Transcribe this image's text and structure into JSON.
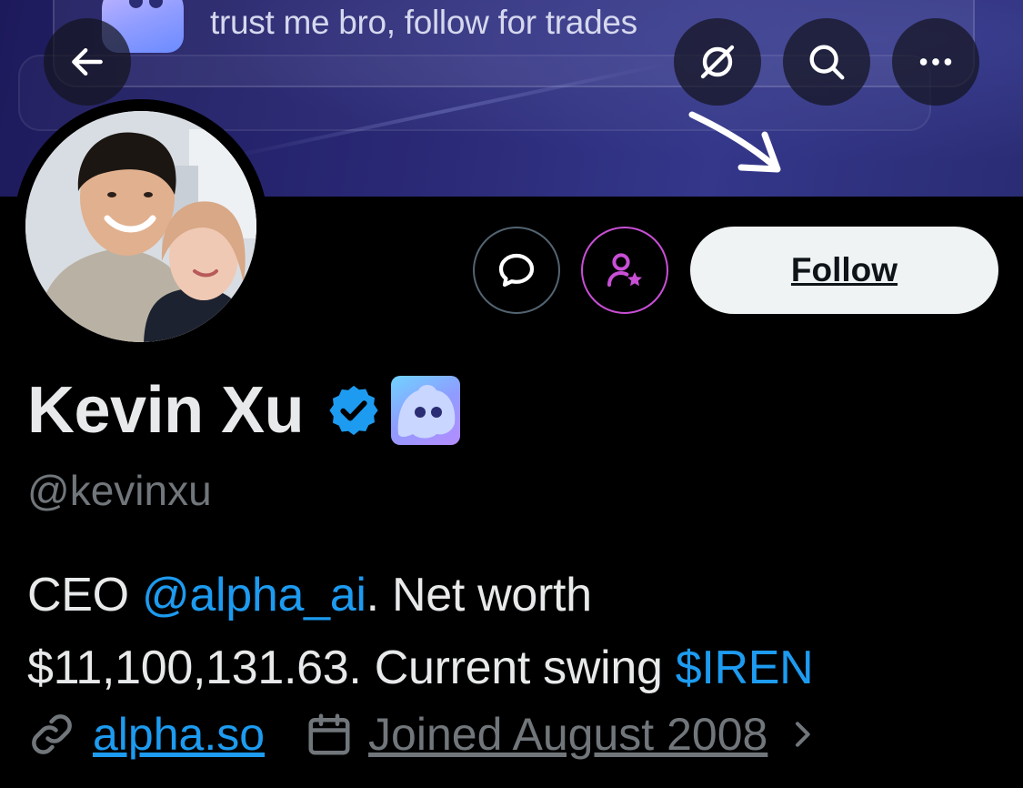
{
  "banner": {
    "text": "trust me bro, follow for trades"
  },
  "header": {
    "back_icon": "arrow-left-icon",
    "grok_icon": "grok-icon",
    "search_icon": "search-icon",
    "more_icon": "more-icon"
  },
  "actions": {
    "message_icon": "message-icon",
    "subscribe_icon": "subscribe-icon",
    "follow_label": "Follow"
  },
  "profile": {
    "display_name": "Kevin Xu",
    "handle": "@kevinxu",
    "verified_badge": "verified-badge-icon",
    "affiliate_badge": "affiliate-logo-icon",
    "bio": {
      "prefix": "CEO ",
      "mention": "@alpha_ai",
      "middle": ". Net worth",
      "line2": "$11,100,131.63. Current swing ",
      "cashtag": "$IREN"
    },
    "website": "alpha.so",
    "joined": "Joined August 2008"
  },
  "colors": {
    "accent": "#1d9bf0",
    "subscribe": "#c94fd6",
    "muted": "#71767b",
    "text": "#e7e9ea",
    "background": "#000000"
  }
}
